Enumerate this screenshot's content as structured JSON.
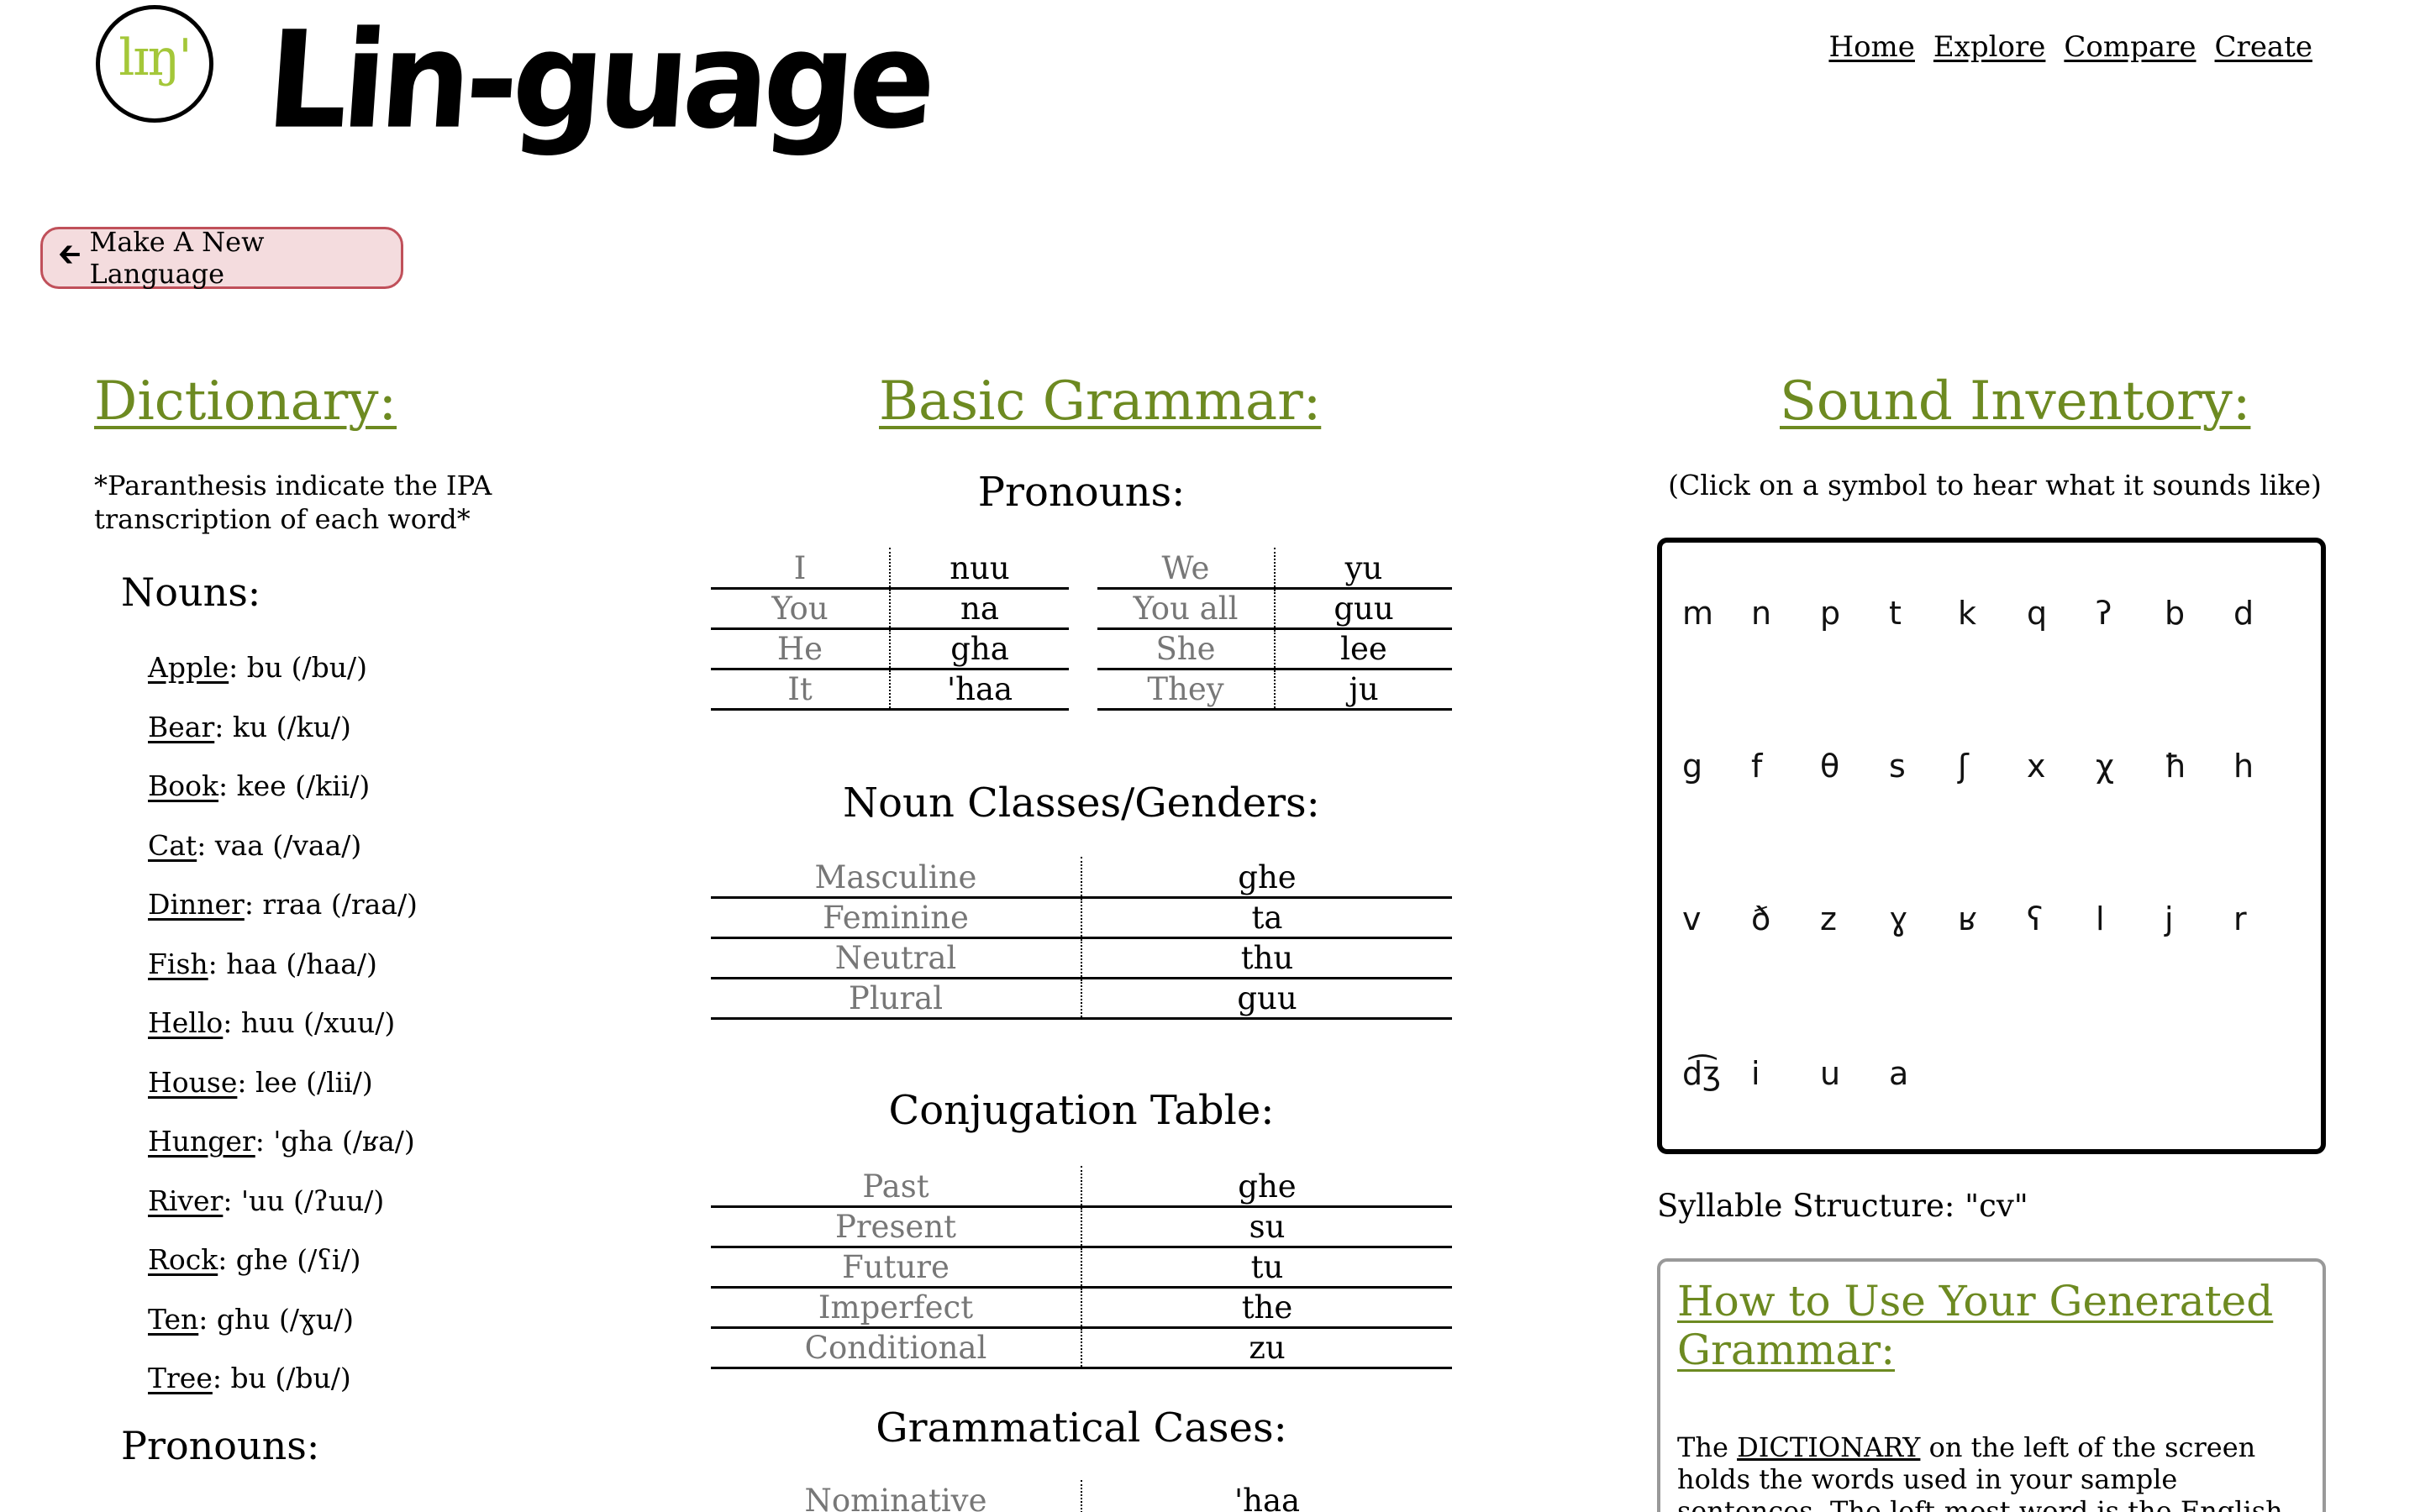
{
  "header": {
    "logo_text": "lɪŋ'",
    "brand": "Lin-guage",
    "nav": [
      "Home",
      "Explore",
      "Compare",
      "Create"
    ]
  },
  "make_button": {
    "icon": "arrow-left-icon",
    "label": "Make A New Language"
  },
  "dictionary": {
    "title": "Dictionary:",
    "note": "*Paranthesis indicate the IPA transcription of each word*",
    "nouns_heading": "Nouns:",
    "nouns": [
      {
        "word": "Apple",
        "rest": ": bu (/bu/)"
      },
      {
        "word": "Bear",
        "rest": ": ku (/ku/)"
      },
      {
        "word": "Book",
        "rest": ": kee (/kii/)"
      },
      {
        "word": "Cat",
        "rest": ": vaa (/vaa/)"
      },
      {
        "word": "Dinner",
        "rest": ": rraa (/raa/)"
      },
      {
        "word": "Fish",
        "rest": ": haa (/haa/)"
      },
      {
        "word": "Hello",
        "rest": ": huu (/xuu/)"
      },
      {
        "word": "House",
        "rest": ": lee (/lii/)"
      },
      {
        "word": "Hunger",
        "rest": ": 'gha (/ʁa/)"
      },
      {
        "word": "River",
        "rest": ": 'uu (/ʔuu/)"
      },
      {
        "word": "Rock",
        "rest": ": ghe (/ʕi/)"
      },
      {
        "word": "Ten",
        "rest": ": ghu (/ɣu/)"
      },
      {
        "word": "Tree",
        "rest": ": bu (/bu/)"
      }
    ],
    "pronouns_heading": "Pronouns:"
  },
  "grammar": {
    "title": "Basic Grammar:",
    "pronouns_heading": "Pronouns:",
    "pronouns_left": [
      [
        "I",
        "nuu"
      ],
      [
        "You",
        "na"
      ],
      [
        "He",
        "gha"
      ],
      [
        "It",
        "'haa"
      ]
    ],
    "pronouns_right": [
      [
        "We",
        "yu"
      ],
      [
        "You all",
        "guu"
      ],
      [
        "She",
        "lee"
      ],
      [
        "They",
        "ju"
      ]
    ],
    "noun_classes_heading": "Noun Classes/Genders:",
    "noun_classes": [
      [
        "Masculine",
        "ghe"
      ],
      [
        "Feminine",
        "ta"
      ],
      [
        "Neutral",
        "thu"
      ],
      [
        "Plural",
        "guu"
      ]
    ],
    "conjugation_heading": "Conjugation Table:",
    "conjugation": [
      [
        "Past",
        "ghe"
      ],
      [
        "Present",
        "su"
      ],
      [
        "Future",
        "tu"
      ],
      [
        "Imperfect",
        "the"
      ],
      [
        "Conditional",
        "zu"
      ]
    ],
    "cases_heading": "Grammatical Cases:",
    "cases": [
      [
        "Nominative",
        "'haa"
      ]
    ]
  },
  "sounds": {
    "title": "Sound Inventory:",
    "hint": "(Click on a symbol to hear what it sounds like)",
    "rows": [
      [
        "m",
        "n",
        "p",
        "t",
        "k",
        "q",
        "ʔ",
        "b",
        "d"
      ],
      [
        "g",
        "f",
        "θ",
        "s",
        "ʃ",
        "x",
        "χ",
        "ħ",
        "h"
      ],
      [
        "v",
        "ð",
        "z",
        "ɣ",
        "ʁ",
        "ʕ",
        "l",
        "j",
        "r"
      ],
      [
        "d͡ʒ",
        "i",
        "u",
        "a"
      ]
    ],
    "syllable_structure": "Syllable Structure: \"cv\""
  },
  "how_to": {
    "title": "How to Use Your Generated Grammar:",
    "text_before": "The ",
    "link": "DICTIONARY",
    "text_after": " on the left of the screen holds the words used in your sample sentences. The left-most word is the English definition"
  }
}
